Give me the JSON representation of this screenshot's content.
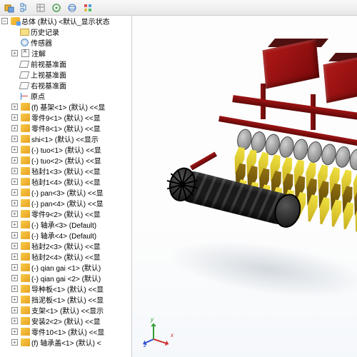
{
  "toolbar": {
    "icons": [
      "assembly",
      "feature-tree",
      "property",
      "config",
      "display",
      "appearance",
      "filter"
    ]
  },
  "tree": {
    "root": "总体 (默认) <默认_显示状态",
    "history": "历史记录",
    "sensors": "传感器",
    "annotations": "注解",
    "plane_front": "前视基准面",
    "plane_top": "上视基准面",
    "plane_right": "右视基准面",
    "origin": "原点",
    "items": [
      "(f) 基架<1> (默认) <<显",
      "零件9<1> (默认) <<显",
      "零件8<1> (默认) <<显",
      "shi<1> (默认) <<显示",
      "(-) tuo<1> (默认) <<显",
      "(-) tuo<2> (默认) <<显",
      "毡封1<3> (默认) <<显",
      "毡封1<4> (默认) <<显",
      "(-) pan<3> (默认) <<显",
      "(-) pan<4> (默认) <<显",
      "零件9<2> (默认) <<显",
      "(-) 轴承<3> (Default)",
      "(-) 轴承<4> (Default)",
      "毡封2<3> (默认) <<显",
      "毡封2<4> (默认) <<显",
      "(-) qian  gai <1> (默认)",
      "(-) qian  gai <2> (默认)",
      "导种板<1> (默认) <<显",
      "挡泥板<1> (默认) <<显",
      "支架<1> (默认) <<显示",
      "安装2<2> (默认) <<显",
      "零件10<1> (默认) <<显",
      "(f) 轴承盖<1> (默认) <"
    ]
  },
  "triad": {
    "x": "x",
    "y": "y",
    "z": "z"
  }
}
